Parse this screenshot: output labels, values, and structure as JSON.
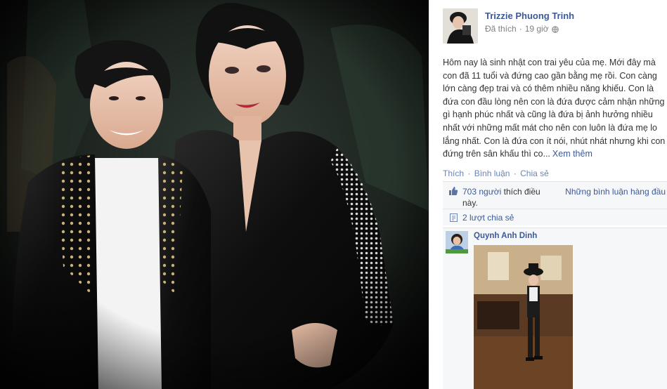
{
  "post": {
    "author_name": "Trizzie Phuong Trinh",
    "liked_label": "Đã thích",
    "separator": "·",
    "time": "19 giờ",
    "text": "Hôm nay là sinh nhật con trai yêu của mẹ. Mới đây mà con đã 11 tuổi và đứng cao gần bằng mẹ rồi. Con càng lớn càng đẹp trai và có thêm nhiều năng khiếu. Con là đứa con đầu lòng nên con là đứa được cảm nhận những gì hạnh phúc nhất và cũng là đứa bị ảnh hưởng nhiều nhất với những mất mát cho nên con luôn là đứa mẹ lo lắng nhất. Con là đứa con ít nói, nhút nhát nhưng khi con đứng trên sân khấu thì co...",
    "see_more": "Xem thêm"
  },
  "actions": {
    "like": "Thích",
    "comment": "Bình luận",
    "share": "Chia sẻ",
    "sep": "·"
  },
  "likes": {
    "count": "703 người",
    "suffix": "thích điều này.",
    "sort_label": "Những bình luận hàng đầu"
  },
  "shares": {
    "label": "2 lượt chia sẻ"
  },
  "comment": {
    "author": "Quynh Anh Dinh"
  },
  "icons": {
    "privacy": "globe-icon",
    "like": "thumbs-up-icon",
    "share": "share-icon",
    "sort": "caret-down-icon"
  },
  "colors": {
    "link": "#3b5998",
    "muted": "#7f7f7f",
    "panel_bg": "#f6f7f9"
  }
}
